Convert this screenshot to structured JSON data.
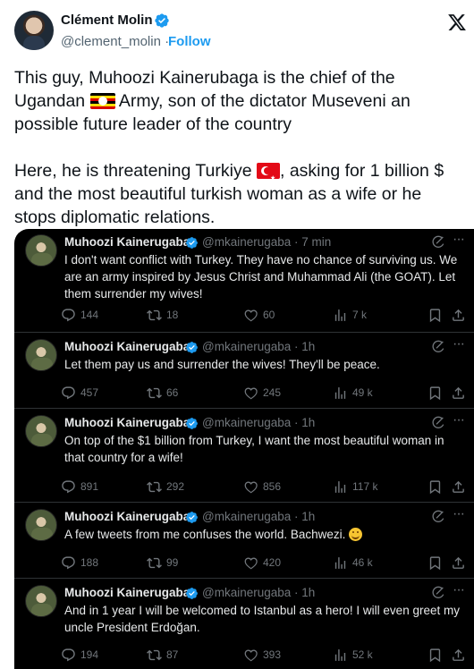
{
  "author": {
    "name": "Clément Molin",
    "handle": "@clement_molin",
    "separator": "·",
    "follow": "Follow"
  },
  "tweet": {
    "line1": "This guy, Muhoozi Kainerubaga is the chief of the",
    "line2a": "Ugandan ",
    "line2b": " Army, son of the dictator Museveni an",
    "line3": "possible future leader of the country",
    "line4": "",
    "line5a": "Here, he is threatening Turkiye ",
    "line5b": ", asking for 1 billion $",
    "line6": "and the most beautiful turkish woman as a wife or he",
    "line7": "stops diplomatic relations."
  },
  "quotes": [
    {
      "name": "Muhoozi Kainerugaba",
      "handle": "@mkainerugaba · 7 min",
      "text": "I don't want conflict with Turkey. They have no chance of surviving us. We are an army inspired by Jesus Christ and Muhammad Ali (the GOAT). Let them surrender my wives!",
      "replies": "144",
      "retweets": "18",
      "likes": "60",
      "views": "7 k"
    },
    {
      "name": "Muhoozi Kainerugaba",
      "handle": "@mkainerugaba · 1h",
      "text": "Let them pay us and surrender the wives! They'll be peace.",
      "replies": "457",
      "retweets": "66",
      "likes": "245",
      "views": "49 k"
    },
    {
      "name": "Muhoozi Kainerugaba",
      "handle": "@mkainerugaba · 1h",
      "text": "On top of the $1 billion from Turkey, I want the most beautiful woman in that country for a wife!",
      "replies": "891",
      "retweets": "292",
      "likes": "856",
      "views": "117 k"
    },
    {
      "name": "Muhoozi Kainerugaba",
      "handle": "@mkainerugaba · 1h",
      "text": "A few tweets from me confuses the world. Bachwezi. ",
      "replies": "188",
      "retweets": "99",
      "likes": "420",
      "views": "46 k"
    },
    {
      "name": "Muhoozi Kainerugaba",
      "handle": "@mkainerugaba · 1h",
      "text": "And in 1 year I will be welcomed to Istanbul as a hero! I will even greet my uncle President Erdoğan.",
      "replies": "194",
      "retweets": "87",
      "likes": "393",
      "views": "52 k"
    }
  ],
  "colors": {
    "accent": "#1d9bf0",
    "dark_bg": "#000000",
    "muted": "#71767b"
  },
  "icons": [
    "verified-badge-icon",
    "x-logo-icon",
    "grok-icon",
    "more-icon",
    "reply-icon",
    "retweet-icon",
    "like-icon",
    "views-icon",
    "bookmark-icon",
    "share-icon",
    "flag-uganda-icon",
    "flag-turkey-icon",
    "smile-emoji-icon"
  ]
}
